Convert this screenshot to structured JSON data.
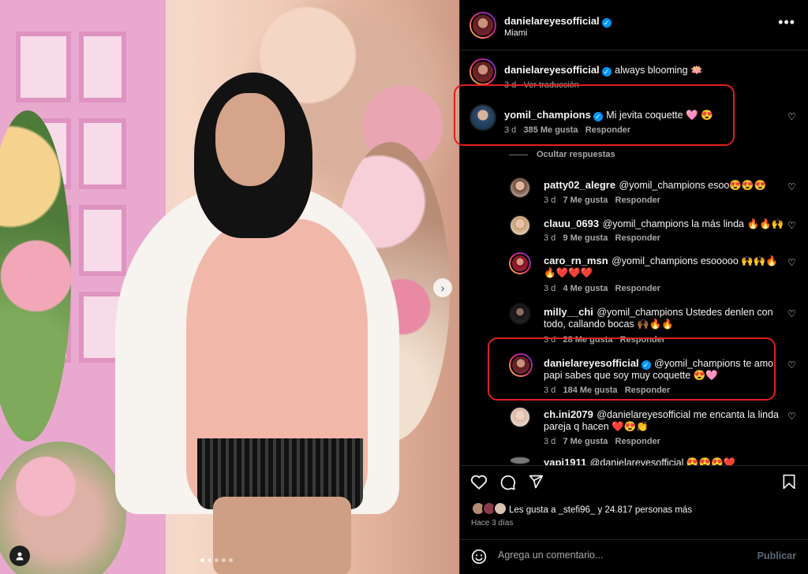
{
  "header": {
    "username": "danielareyesofficial",
    "location": "Miami",
    "more_icon": "more-horizontal-icon"
  },
  "caption": {
    "username": "danielareyesofficial",
    "text": "always blooming 🪷",
    "time": "3 d",
    "translate": "Ver traducción"
  },
  "main_comment": {
    "username": "yomil_champions",
    "text": "Mi jevita coquette 🩷 😍",
    "time": "3 d",
    "likes": "385 Me gusta",
    "reply": "Responder",
    "hide_replies": "Ocultar respuestas"
  },
  "replies": [
    {
      "username": "patty02_alegre",
      "text": "@yomil_champions esoo😍😍😍",
      "time": "3 d",
      "likes": "7 Me gusta",
      "reply": "Responder"
    },
    {
      "username": "clauu_0693",
      "text": "@yomil_champions la más linda 🔥🔥🙌",
      "time": "3 d",
      "likes": "9 Me gusta",
      "reply": "Responder"
    },
    {
      "username": "caro_rn_msn",
      "text": "@yomil_champions esooooo 🙌🙌🔥",
      "text2": "🔥❤️❤️❤️",
      "time": "3 d",
      "likes": "4 Me gusta",
      "reply": "Responder"
    },
    {
      "username": "milly__chi",
      "text": "@yomil_champions Ustedes denlen con",
      "text2": "todo, callando bocas 🙌🏾🔥🔥",
      "time": "3 d",
      "likes": "28 Me gusta",
      "reply": "Responder"
    },
    {
      "username": "danielareyesofficial",
      "text": "@yomil_champions te amo",
      "text2": "papi sabes que soy muy coquette 😍🩷",
      "time": "3 d",
      "likes": "184 Me gusta",
      "reply": "Responder"
    },
    {
      "username": "ch.ini2079",
      "text": "@danielareyesofficial me encanta la linda",
      "text2": "pareja q hacen ❤️😍👏",
      "time": "3 d",
      "likes": "7 Me gusta",
      "reply": "Responder"
    },
    {
      "username": "yapi1911",
      "text": "@danielareyesofficial 😍😍😍❤️"
    }
  ],
  "actions": {
    "like_icon": "heart-icon",
    "comment_icon": "comment-icon",
    "share_icon": "send-icon",
    "save_icon": "bookmark-icon"
  },
  "likes_summary": "Les gusta a _stefi96_ y 24.817 personas más",
  "posted": "Hace 3 días",
  "comment_box": {
    "placeholder": "Agrega un comentario...",
    "publish": "Publicar",
    "emoji_icon": "smiley-icon"
  },
  "colors": {
    "highlight_box": "#e0201e",
    "verified": "#0095f6",
    "background": "#000000"
  }
}
